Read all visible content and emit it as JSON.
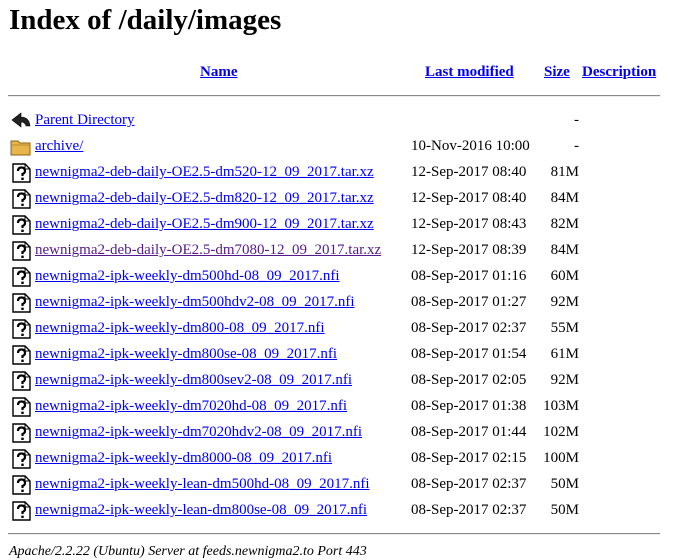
{
  "page": {
    "title": "Index of /daily/images"
  },
  "columns": {
    "name": "Name",
    "last_modified": "Last modified",
    "size": "Size",
    "description": "Description"
  },
  "rows": [
    {
      "icon": "back-icon",
      "name": "Parent Directory",
      "date": "",
      "size": "-",
      "visited": false
    },
    {
      "icon": "folder-icon",
      "name": "archive/",
      "date": "10-Nov-2016 10:00",
      "size": "-",
      "visited": false
    },
    {
      "icon": "unknown-file-icon",
      "name": "newnigma2-deb-daily-OE2.5-dm520-12_09_2017.tar.xz",
      "date": "12-Sep-2017 08:40",
      "size": "81M",
      "visited": false
    },
    {
      "icon": "unknown-file-icon",
      "name": "newnigma2-deb-daily-OE2.5-dm820-12_09_2017.tar.xz",
      "date": "12-Sep-2017 08:40",
      "size": "84M",
      "visited": false
    },
    {
      "icon": "unknown-file-icon",
      "name": "newnigma2-deb-daily-OE2.5-dm900-12_09_2017.tar.xz",
      "date": "12-Sep-2017 08:43",
      "size": "82M",
      "visited": false
    },
    {
      "icon": "unknown-file-icon",
      "name": "newnigma2-deb-daily-OE2.5-dm7080-12_09_2017.tar.xz",
      "date": "12-Sep-2017 08:39",
      "size": "84M",
      "visited": true
    },
    {
      "icon": "unknown-file-icon",
      "name": "newnigma2-ipk-weekly-dm500hd-08_09_2017.nfi",
      "date": "08-Sep-2017 01:16",
      "size": "60M",
      "visited": false
    },
    {
      "icon": "unknown-file-icon",
      "name": "newnigma2-ipk-weekly-dm500hdv2-08_09_2017.nfi",
      "date": "08-Sep-2017 01:27",
      "size": "92M",
      "visited": false
    },
    {
      "icon": "unknown-file-icon",
      "name": "newnigma2-ipk-weekly-dm800-08_09_2017.nfi",
      "date": "08-Sep-2017 02:37",
      "size": "55M",
      "visited": false
    },
    {
      "icon": "unknown-file-icon",
      "name": "newnigma2-ipk-weekly-dm800se-08_09_2017.nfi",
      "date": "08-Sep-2017 01:54",
      "size": "61M",
      "visited": false
    },
    {
      "icon": "unknown-file-icon",
      "name": "newnigma2-ipk-weekly-dm800sev2-08_09_2017.nfi",
      "date": "08-Sep-2017 02:05",
      "size": "92M",
      "visited": false
    },
    {
      "icon": "unknown-file-icon",
      "name": "newnigma2-ipk-weekly-dm7020hd-08_09_2017.nfi",
      "date": "08-Sep-2017 01:38",
      "size": "103M",
      "visited": false
    },
    {
      "icon": "unknown-file-icon",
      "name": "newnigma2-ipk-weekly-dm7020hdv2-08_09_2017.nfi",
      "date": "08-Sep-2017 01:44",
      "size": "102M",
      "visited": false
    },
    {
      "icon": "unknown-file-icon",
      "name": "newnigma2-ipk-weekly-dm8000-08_09_2017.nfi",
      "date": "08-Sep-2017 02:15",
      "size": "100M",
      "visited": false
    },
    {
      "icon": "unknown-file-icon",
      "name": "newnigma2-ipk-weekly-lean-dm500hd-08_09_2017.nfi",
      "date": "08-Sep-2017 02:37",
      "size": "50M",
      "visited": false
    },
    {
      "icon": "unknown-file-icon",
      "name": "newnigma2-ipk-weekly-lean-dm800se-08_09_2017.nfi",
      "date": "08-Sep-2017 02:37",
      "size": "50M",
      "visited": false
    }
  ],
  "footer": {
    "text": "Apache/2.2.22 (Ubuntu) Server at feeds.newnigma2.to Port 443"
  },
  "colors": {
    "link": "#0000ee",
    "visited_link": "#551a8b",
    "rule": "#8a8a8a"
  }
}
